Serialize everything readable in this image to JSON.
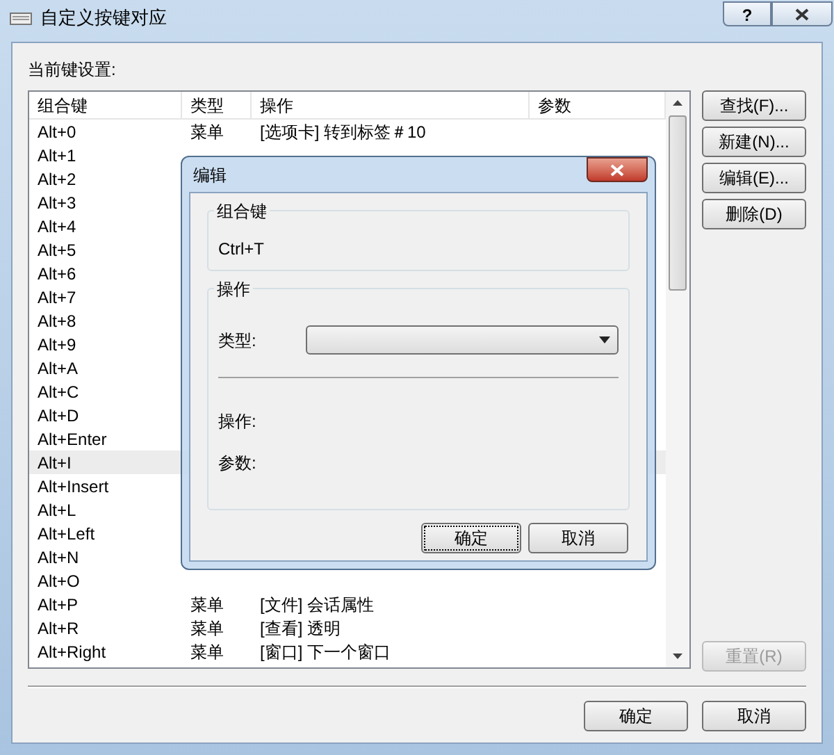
{
  "window": {
    "title": "自定义按键对应",
    "help": "?"
  },
  "list_label": "当前键设置:",
  "table": {
    "columns": [
      "组合键",
      "类型",
      "操作",
      "参数"
    ],
    "rows": [
      {
        "key": "Alt+0",
        "type": "菜单",
        "action": "[选项卡] 转到标签＃10",
        "selected": false
      },
      {
        "key": "Alt+1",
        "selected": false
      },
      {
        "key": "Alt+2",
        "selected": false
      },
      {
        "key": "Alt+3",
        "selected": false
      },
      {
        "key": "Alt+4",
        "selected": false
      },
      {
        "key": "Alt+5",
        "selected": false
      },
      {
        "key": "Alt+6",
        "selected": false
      },
      {
        "key": "Alt+7",
        "selected": false
      },
      {
        "key": "Alt+8",
        "selected": false
      },
      {
        "key": "Alt+9",
        "selected": false
      },
      {
        "key": "Alt+A",
        "selected": false
      },
      {
        "key": "Alt+C",
        "selected": false
      },
      {
        "key": "Alt+D",
        "selected": false
      },
      {
        "key": "Alt+Enter",
        "selected": false
      },
      {
        "key": "Alt+I",
        "selected": true
      },
      {
        "key": "Alt+Insert",
        "selected": false
      },
      {
        "key": "Alt+L",
        "selected": false
      },
      {
        "key": "Alt+Left",
        "selected": false
      },
      {
        "key": "Alt+N",
        "selected": false
      },
      {
        "key": "Alt+O",
        "selected": false
      },
      {
        "key": "Alt+P",
        "type": "菜单",
        "action": "[文件] 会话属性",
        "selected": false
      },
      {
        "key": "Alt+R",
        "type": "菜单",
        "action": "[查看] 透明",
        "selected": false
      },
      {
        "key": "Alt+Right",
        "type": "菜单",
        "action": "[窗口] 下一个窗口",
        "selected": false
      }
    ]
  },
  "side_buttons": [
    {
      "label": "查找(F)...",
      "disabled": false
    },
    {
      "label": "新建(N)...",
      "disabled": false
    },
    {
      "label": "编辑(E)...",
      "disabled": false
    },
    {
      "label": "删除(D)",
      "disabled": false
    }
  ],
  "reset_button": {
    "label": "重置(R)",
    "disabled": true
  },
  "buttons": [
    "确定",
    "取消"
  ],
  "dialog": {
    "title": "编辑",
    "key_group": {
      "title": "组合键",
      "value": "Ctrl+T"
    },
    "action_group": {
      "title": "操作",
      "type_label": "类型:",
      "action_label": "操作:",
      "param_label": "参数:"
    },
    "buttons": [
      {
        "label": "确定",
        "focused": true
      },
      {
        "label": "取消",
        "focused": false
      }
    ]
  }
}
